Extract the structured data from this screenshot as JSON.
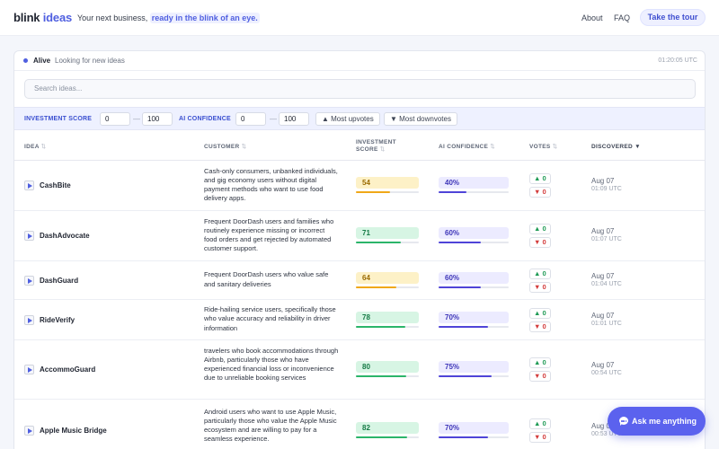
{
  "header": {
    "brand_part1": "blink",
    "brand_part2": "ideas",
    "tagline_prefix": "Your next business, ",
    "tagline_highlight": "ready in the blink of an eye.",
    "nav_about": "About",
    "nav_faq": "FAQ",
    "tour_button": "Take the tour"
  },
  "status": {
    "state": "Alive",
    "message": "Looking for new ideas",
    "time": "01:20:05 UTC"
  },
  "search": {
    "placeholder": "Search ideas..."
  },
  "filters": {
    "investment_label": "INVESTMENT SCORE",
    "investment_min": "0",
    "investment_max": "100",
    "confidence_label": "AI CONFIDENCE",
    "confidence_min": "0",
    "confidence_max": "100",
    "dash": "—",
    "sort_upvotes": "▲ Most upvotes",
    "sort_downvotes": "▼ Most downvotes"
  },
  "columns": {
    "idea": "IDEA",
    "customer": "CUSTOMER",
    "investment_line1": "INVESTMENT",
    "investment_line2": "SCORE",
    "confidence": "AI CONFIDENCE",
    "votes": "VOTES",
    "discovered": "DISCOVERED ▼",
    "sort_icon": "⇅"
  },
  "colors": {
    "accent": "#4f5fe0",
    "score_yellow_bg": "#fdf1c7",
    "score_yellow_text": "#9a6a00",
    "score_yellow_bar": "#f0a818",
    "score_green_bg": "#d7f5e4",
    "score_green_text": "#157a45",
    "score_green_bar": "#2bb56a",
    "confidence_bar": "#4f44d8"
  },
  "rows": [
    {
      "name": "CashBite",
      "customer": "Cash-only consumers, unbanked individuals, and gig economy users without digital payment methods who want to use food delivery apps.",
      "score": "54",
      "score_fraction": 0.54,
      "score_tone": "yellow",
      "confidence": "40%",
      "confidence_fraction": 0.4,
      "upvotes": "▲ 0",
      "downvotes": "▼ 0",
      "date": "Aug 07",
      "time": "01:09 UTC"
    },
    {
      "name": "DashAdvocate",
      "customer": "Frequent DoorDash users and families who routinely experience missing or incorrect food orders and get rejected by automated customer support.",
      "score": "71",
      "score_fraction": 0.71,
      "score_tone": "green",
      "confidence": "60%",
      "confidence_fraction": 0.6,
      "upvotes": "▲ 0",
      "downvotes": "▼ 0",
      "date": "Aug 07",
      "time": "01:07 UTC"
    },
    {
      "name": "DashGuard",
      "customer": "Frequent DoorDash users who value safe and sanitary deliveries",
      "score": "64",
      "score_fraction": 0.64,
      "score_tone": "yellow",
      "confidence": "60%",
      "confidence_fraction": 0.6,
      "upvotes": "▲ 0",
      "downvotes": "▼ 0",
      "date": "Aug 07",
      "time": "01:04 UTC"
    },
    {
      "name": "RideVerify",
      "customer": "Ride-hailing service users, specifically those who value accuracy and reliability in driver information",
      "score": "78",
      "score_fraction": 0.78,
      "score_tone": "green",
      "confidence": "70%",
      "confidence_fraction": 0.7,
      "upvotes": "▲ 0",
      "downvotes": "▼ 0",
      "date": "Aug 07",
      "time": "01:01 UTC"
    },
    {
      "name": "AccommoGuard",
      "customer": "travelers who book accommodations through Airbnb, particularly those who have experienced financial loss or inconvenience due to unreliable booking services",
      "score": "80",
      "score_fraction": 0.8,
      "score_tone": "green",
      "confidence": "75%",
      "confidence_fraction": 0.75,
      "upvotes": "▲ 0",
      "downvotes": "▼ 0",
      "date": "Aug 07",
      "time": "00:54 UTC"
    },
    {
      "name": "Apple Music Bridge",
      "customer": "Android users who want to use Apple Music, particularly those who value the Apple Music ecosystem and are willing to pay for a seamless experience.",
      "score": "82",
      "score_fraction": 0.82,
      "score_tone": "green",
      "confidence": "70%",
      "confidence_fraction": 0.7,
      "upvotes": "▲ 0",
      "downvotes": "▼ 0",
      "date": "Aug 07",
      "time": "00:53 UTC"
    }
  ],
  "chat": {
    "label": "Ask me anything",
    "icon": "chat-bubble-icon"
  }
}
